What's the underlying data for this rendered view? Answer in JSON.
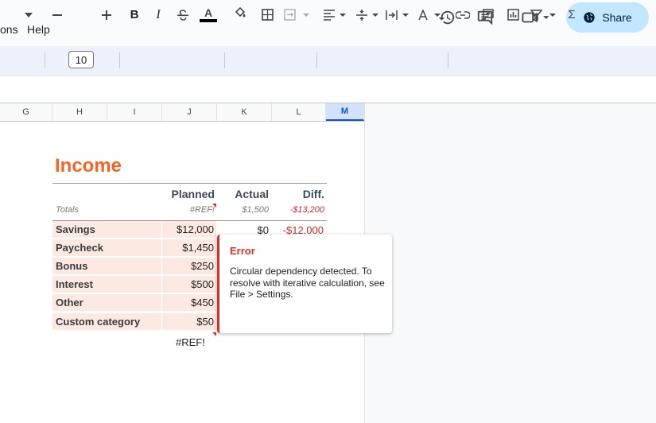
{
  "menu": {
    "items": [
      "ons",
      "Help"
    ]
  },
  "header": {
    "share_label": "Share"
  },
  "toolbar": {
    "font_size": "10"
  },
  "columns": [
    {
      "label": "G",
      "selected": false
    },
    {
      "label": "H",
      "selected": false
    },
    {
      "label": "I",
      "selected": false
    },
    {
      "label": "J",
      "selected": false
    },
    {
      "label": "K",
      "selected": false
    },
    {
      "label": "L",
      "selected": false
    },
    {
      "label": "M",
      "selected": true
    }
  ],
  "sheet": {
    "title": "Income",
    "headers": {
      "planned": "Planned",
      "actual": "Actual",
      "diff": "Diff."
    },
    "totals": {
      "label": "Totals",
      "planned": "#REF!",
      "actual": "$1,500",
      "diff": "-$13,200"
    },
    "rows": [
      {
        "label": "Savings",
        "planned": "$12,000",
        "actual": "$0",
        "diff": "-$12,000"
      },
      {
        "label": "Paycheck",
        "planned": "$1,450",
        "actual": "",
        "diff": ""
      },
      {
        "label": "Bonus",
        "planned": "$250",
        "actual": "",
        "diff": ""
      },
      {
        "label": "Interest",
        "planned": "$500",
        "actual": "",
        "diff": ""
      },
      {
        "label": "Other",
        "planned": "$450",
        "actual": "",
        "diff": ""
      },
      {
        "label": "Custom category",
        "planned": "$50",
        "actual": "",
        "diff": ""
      }
    ],
    "below_value": "#REF!"
  },
  "error_popup": {
    "title": "Error",
    "message": "Circular dependency detected. To resolve with iterative calculation, see File > Settings."
  },
  "colors": {
    "accent": "#f46524",
    "error": "#d93025",
    "share_bg": "#c2e7ff",
    "row_fill": "#fce9e1"
  }
}
